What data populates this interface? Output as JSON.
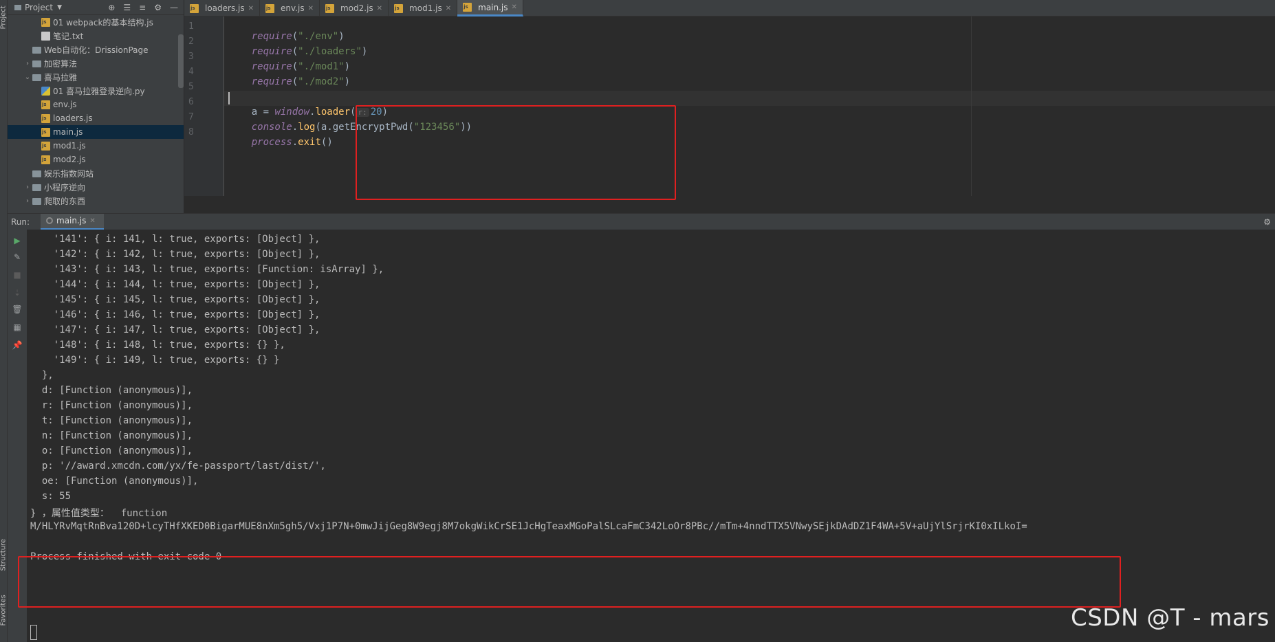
{
  "left_stripe": {
    "top_label": "Project",
    "structure_label": "Structure",
    "favorites_label": "Favorites"
  },
  "project": {
    "title": "Project",
    "tree": [
      {
        "label": "01 webpack的基本结构.js",
        "type": "js",
        "indent": 3,
        "selected": false,
        "arrow": ""
      },
      {
        "label": "笔记.txt",
        "type": "txt",
        "indent": 3,
        "selected": false,
        "arrow": ""
      },
      {
        "label": "Web自动化：DrissionPage",
        "type": "folder",
        "indent": 2,
        "selected": false,
        "arrow": ""
      },
      {
        "label": "加密算法",
        "type": "folder",
        "indent": 2,
        "selected": false,
        "arrow": ">"
      },
      {
        "label": "喜马拉雅",
        "type": "folder",
        "indent": 2,
        "selected": false,
        "arrow": "v"
      },
      {
        "label": "01 喜马拉雅登录逆向.py",
        "type": "py",
        "indent": 3,
        "selected": false,
        "arrow": ""
      },
      {
        "label": "env.js",
        "type": "js",
        "indent": 3,
        "selected": false,
        "arrow": ""
      },
      {
        "label": "loaders.js",
        "type": "js",
        "indent": 3,
        "selected": false,
        "arrow": ""
      },
      {
        "label": "main.js",
        "type": "js",
        "indent": 3,
        "selected": true,
        "arrow": ""
      },
      {
        "label": "mod1.js",
        "type": "js",
        "indent": 3,
        "selected": false,
        "arrow": ""
      },
      {
        "label": "mod2.js",
        "type": "js",
        "indent": 3,
        "selected": false,
        "arrow": ""
      },
      {
        "label": "娱乐指数网站",
        "type": "folder",
        "indent": 2,
        "selected": false,
        "arrow": ""
      },
      {
        "label": "小程序逆向",
        "type": "folder",
        "indent": 2,
        "selected": false,
        "arrow": ">"
      },
      {
        "label": "爬取的东西",
        "type": "folder",
        "indent": 2,
        "selected": false,
        "arrow": ">"
      }
    ]
  },
  "tabs": [
    {
      "label": "loaders.js",
      "active": false
    },
    {
      "label": "env.js",
      "active": false
    },
    {
      "label": "mod2.js",
      "active": false
    },
    {
      "label": "mod1.js",
      "active": false
    },
    {
      "label": "main.js",
      "active": true
    }
  ],
  "editor": {
    "line_numbers": [
      "1",
      "2",
      "3",
      "4",
      "5",
      "6",
      "7",
      "8"
    ],
    "lines": {
      "l1": {
        "kw": "require",
        "open": "(",
        "str": "\"./env\"",
        "close": ")"
      },
      "l2": {
        "kw": "require",
        "open": "(",
        "str": "\"./loaders\"",
        "close": ")"
      },
      "l3": {
        "kw": "require",
        "open": "(",
        "str": "\"./mod1\"",
        "close": ")"
      },
      "l4": {
        "kw": "require",
        "open": "(",
        "str": "\"./mod2\"",
        "close": ")"
      },
      "l6": {
        "var": "a = ",
        "obj": "window",
        "dot": ".",
        "fn": "loader",
        "open": "(",
        "hint": "r:",
        "num": "20",
        "close": ")"
      },
      "l7": {
        "obj": "console",
        "dot": ".",
        "fn": "log",
        "arg_pre": "(a.getEncryptPwd(",
        "str": "\"123456\"",
        "close": "))"
      },
      "l8": {
        "obj": "process",
        "dot": ".",
        "fn": "exit",
        "close": "()"
      }
    }
  },
  "run": {
    "label": "Run:",
    "tab_label": "main.js",
    "output": [
      "    '141': { i: 141, l: true, exports: [Object] },",
      "    '142': { i: 142, l: true, exports: [Object] },",
      "    '143': { i: 143, l: true, exports: [Function: isArray] },",
      "    '144': { i: 144, l: true, exports: [Object] },",
      "    '145': { i: 145, l: true, exports: [Object] },",
      "    '146': { i: 146, l: true, exports: [Object] },",
      "    '147': { i: 147, l: true, exports: [Object] },",
      "    '148': { i: 148, l: true, exports: {} },",
      "    '149': { i: 149, l: true, exports: {} }",
      "  },",
      "  d: [Function (anonymous)],",
      "  r: [Function (anonymous)],",
      "  t: [Function (anonymous)],",
      "  n: [Function (anonymous)],",
      "  o: [Function (anonymous)],",
      "  p: '//award.xmcdn.com/yx/fe-passport/last/dist/',",
      "  oe: [Function (anonymous)],",
      "  s: 55",
      "} ，属性值类型：  function",
      "M/HLYRvMqtRnBva120D+lcyTHfXKED0BigarMUE8nXm5gh5/Vxj1P7N+0mwJijGeg8W9egj8M7okgWikCrSE1JcHgTeaxMGoPalSLcaFmC342LoOr8PBc//mTm+4nndTTX5VNwySEjkDAdDZ1F4WA+5V+aUjYlSrjrKI0xILkoI=",
      "",
      "Process finished with exit code 0"
    ]
  },
  "watermark": "CSDN @T - mars"
}
